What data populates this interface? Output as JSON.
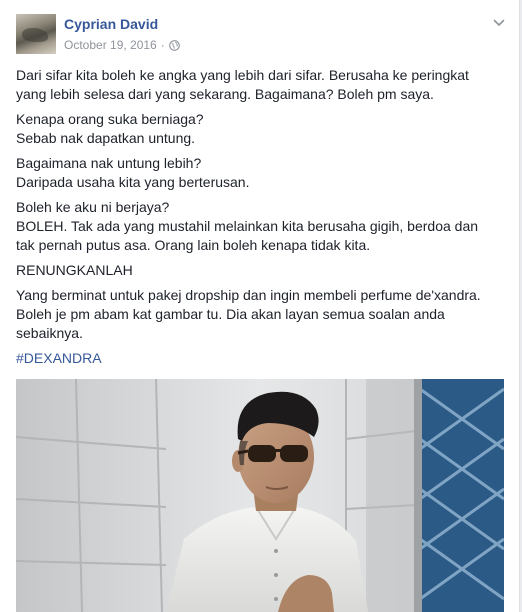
{
  "post": {
    "author": "Cyprian David",
    "date": "October 19, 2016",
    "separator": "·",
    "icons": {
      "privacy": "globe-icon",
      "options": "chevron-down-icon"
    },
    "paragraphs": [
      {
        "lines": [
          "Dari sifar kita boleh ke angka yang lebih dari sifar. Berusaha ke peringkat",
          "yang lebih selesa dari yang sekarang. Bagaimana? Boleh pm saya."
        ]
      },
      {
        "lines": [
          "Kenapa orang suka berniaga?",
          "Sebab nak dapatkan untung."
        ]
      },
      {
        "lines": [
          "Bagaimana nak untung lebih?",
          "Daripada usaha kita yang berterusan."
        ]
      },
      {
        "lines": [
          "Boleh ke aku ni berjaya?",
          "BOLEH. Tak ada yang mustahil melainkan kita berusaha gigih, berdoa dan",
          "tak pernah putus asa. Orang lain boleh kenapa tidak kita."
        ]
      },
      {
        "lines": [
          "RENUNGKANLAH"
        ]
      },
      {
        "lines": [
          "Yang berminat untuk pakej dropship dan ingin membeli perfume de'xandra.",
          "Boleh je pm abam kat gambar tu. Dia akan layan semua soalan anda",
          "sebaiknya."
        ]
      }
    ],
    "hashtag": "#DEXANDRA"
  },
  "colors": {
    "link": "#365899",
    "text": "#1d2129",
    "meta": "#90949c",
    "background": "#e9ebee"
  }
}
